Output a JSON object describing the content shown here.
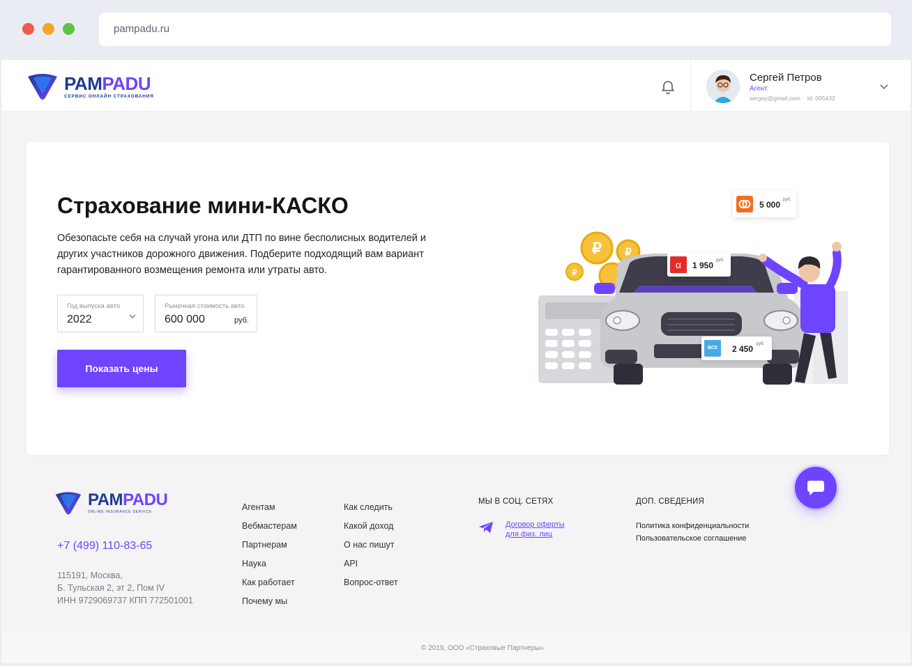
{
  "browser": {
    "url": "pampadu.ru"
  },
  "header": {
    "logo": {
      "part1": "PAM",
      "part2": "PADU",
      "tagline": "СЕРВИС ОНЛАЙН СТРАХОВАНИЯ"
    },
    "user": {
      "name": "Сергей Петров",
      "role": "Агент",
      "email": "sergey@gmail.com",
      "id": "id: 005432"
    }
  },
  "main": {
    "title": "Страхование мини-КАСКО",
    "description": "Обезопасьте себя на случай угона или ДТП по вине бесполисных водителей и других участников дорожного движения. Подберите подходящий вам вариант гарантированного возмещения ремонта или утраты авто.",
    "year_field": {
      "label": "Год выпуска авто",
      "value": "2022"
    },
    "price_field": {
      "label": "Рыночная стоимость авто",
      "value": "600 000",
      "unit": "руб."
    },
    "submit_label": "Показать цены",
    "price_tags": [
      {
        "amount": "5 000",
        "unit": "руб."
      },
      {
        "amount": "1 950",
        "unit": "руб."
      },
      {
        "amount": "2 450",
        "unit": "руб."
      }
    ],
    "insurer_badges": {
      "alpha": "α",
      "vsk": "ВСК"
    }
  },
  "footer": {
    "logo": {
      "part1": "PAM",
      "part2": "PADU",
      "tagline": "ONLINE INSURANCE SERVICE"
    },
    "phone": "+7 (499) 110-83-65",
    "address": [
      "115191, Москва,",
      "Б. Тульская 2, эт 2, Пом IV",
      "ИНН 9729069737 КПП 772501001"
    ],
    "nav_col1": [
      "Агентам",
      "Вебмастерам",
      "Партнерам",
      "Наука",
      "Как работает",
      "Почему мы"
    ],
    "nav_col2": [
      "Как следить",
      "Какой доход",
      "О нас пишут",
      "API",
      "Вопрос-ответ"
    ],
    "social_heading": "МЫ В СОЦ. СЕТЯХ",
    "social_link": [
      "Договор оферты",
      "для физ. лиц"
    ],
    "info_heading": "ДОП. СВЕДЕНИЯ",
    "info_links": [
      "Политика конфиденциальности",
      "Пользовательское соглашение"
    ],
    "copyright": "© 2019, ООО «Страховые Партнеры»"
  },
  "colors": {
    "accent": "#6e44ff",
    "brand_dark": "#1c3c8f"
  }
}
